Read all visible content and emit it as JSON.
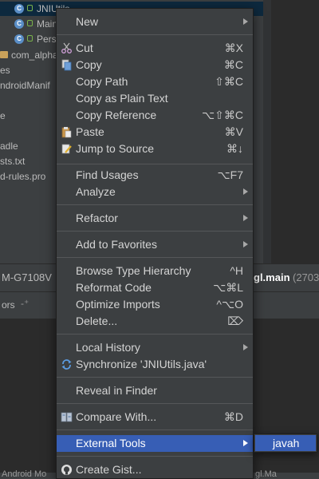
{
  "project_tree": {
    "items": [
      {
        "label": "JNIUtils",
        "kind": "class"
      },
      {
        "label": "Main",
        "kind": "class"
      },
      {
        "label": "Pers",
        "kind": "class"
      },
      {
        "label": "com_alpha",
        "kind": "file"
      },
      {
        "label": "es",
        "kind": "text"
      },
      {
        "label": "ndroidManif",
        "kind": "text"
      },
      {
        "label": "e",
        "kind": "text"
      },
      {
        "label": "adle",
        "kind": "text"
      },
      {
        "label": "sts.txt",
        "kind": "text"
      },
      {
        "label": "d-rules.pro",
        "kind": "text"
      }
    ]
  },
  "status_bar": {
    "device": "M-G7108V",
    "process": "gl.main",
    "pid": "(2703"
  },
  "tool_window": {
    "tab_label": "ors"
  },
  "bottom_bar": {
    "left_text": "Android Mo",
    "right_text": "gl.Ma"
  },
  "context_menu": {
    "items": {
      "new": {
        "label": "New"
      },
      "cut": {
        "label": "Cut",
        "shortcut": "⌘X",
        "icon": "scissors-icon"
      },
      "copy": {
        "label": "Copy",
        "shortcut": "⌘C",
        "icon": "copy-icon"
      },
      "copy_path": {
        "label": "Copy Path",
        "shortcut": "⇧⌘C"
      },
      "copy_plain": {
        "label": "Copy as Plain Text"
      },
      "copy_ref": {
        "label": "Copy Reference",
        "shortcut": "⌥⇧⌘C"
      },
      "paste": {
        "label": "Paste",
        "shortcut": "⌘V",
        "icon": "paste-icon"
      },
      "jump": {
        "label": "Jump to Source",
        "shortcut": "⌘↓",
        "icon": "edit-icon"
      },
      "find_usages": {
        "label": "Find Usages",
        "shortcut": "⌥F7"
      },
      "analyze": {
        "label": "Analyze"
      },
      "refactor": {
        "label": "Refactor"
      },
      "favorites": {
        "label": "Add to Favorites"
      },
      "browse_hierarchy": {
        "label": "Browse Type Hierarchy",
        "shortcut": "^H"
      },
      "reformat": {
        "label": "Reformat Code",
        "shortcut": "⌥⌘L"
      },
      "optimize": {
        "label": "Optimize Imports",
        "shortcut": "^⌥O"
      },
      "delete": {
        "label": "Delete...",
        "shortcut": "⌦"
      },
      "local_history": {
        "label": "Local History"
      },
      "synchronize": {
        "label": "Synchronize 'JNIUtils.java'",
        "icon": "sync-icon"
      },
      "reveal": {
        "label": "Reveal in Finder"
      },
      "compare": {
        "label": "Compare With...",
        "shortcut": "⌘D",
        "icon": "compare-icon"
      },
      "external_tools": {
        "label": "External Tools",
        "active": true
      },
      "create_gist": {
        "label": "Create Gist...",
        "icon": "github-icon"
      }
    },
    "active_color": "#375eb5"
  },
  "submenu": {
    "items": [
      {
        "label": "javah"
      }
    ]
  }
}
